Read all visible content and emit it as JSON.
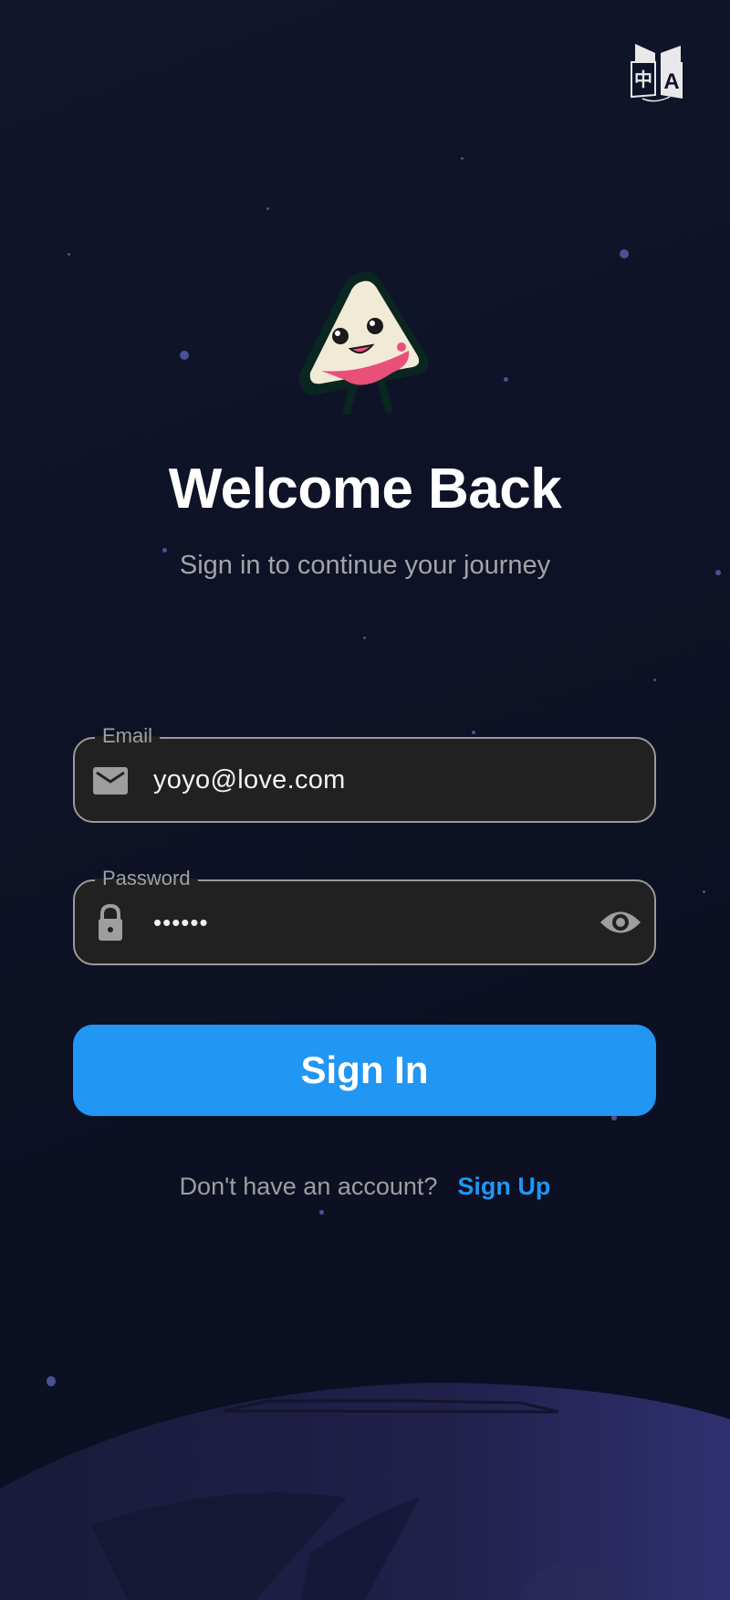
{
  "header": {
    "language_icon": "translate-icon"
  },
  "hero": {
    "mascot": "rice-dumpling-mascot",
    "title": "Welcome Back",
    "subtitle": "Sign in to continue your journey"
  },
  "form": {
    "email": {
      "label": "Email",
      "value": "yoyo@love.com",
      "icon": "mail-icon"
    },
    "password": {
      "label": "Password",
      "value": "••••••",
      "icon": "lock-icon",
      "toggle_icon": "eye-icon"
    },
    "submit_label": "Sign In"
  },
  "footer": {
    "prompt": "Don't have an account?",
    "link": "Sign Up"
  },
  "colors": {
    "accent": "#2196F3",
    "field_bg": "#212121",
    "background": "#0e1226"
  }
}
